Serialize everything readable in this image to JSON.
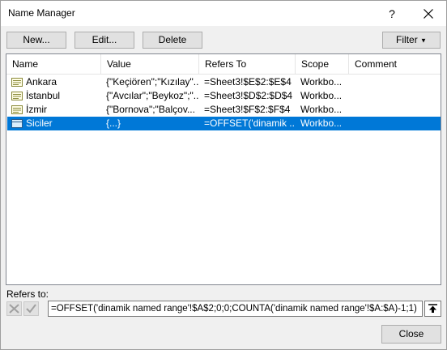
{
  "window": {
    "title": "Name Manager",
    "help_label": "?"
  },
  "toolbar": {
    "new_label": "New...",
    "edit_label": "Edit...",
    "delete_label": "Delete",
    "filter_label": "Filter"
  },
  "table": {
    "columns": [
      "Name",
      "Value",
      "Refers To",
      "Scope",
      "Comment"
    ],
    "rows": [
      {
        "name": "Ankara",
        "value": "{\"Keçiören\";\"Kızılay\"...",
        "refers_to": "=Sheet3!$E$2:$E$4",
        "scope": "Workbo...",
        "comment": "",
        "selected": false
      },
      {
        "name": "İstanbul",
        "value": "{\"Avcılar\";\"Beykoz\";\"...",
        "refers_to": "=Sheet3!$D$2:$D$4",
        "scope": "Workbo...",
        "comment": "",
        "selected": false
      },
      {
        "name": "İzmir",
        "value": "{\"Bornova\";\"Balçov...",
        "refers_to": "=Sheet3!$F$2:$F$4",
        "scope": "Workbo...",
        "comment": "",
        "selected": false
      },
      {
        "name": "Siciler",
        "value": "{...}",
        "refers_to": "=OFFSET('dinamik ...",
        "scope": "Workbo...",
        "comment": "",
        "selected": true
      }
    ]
  },
  "refers": {
    "label": "Refers to:",
    "value": "=OFFSET('dinamik named range'!$A$2;0;0;COUNTA('dinamik named range'!$A:$A)-1;1)"
  },
  "footer": {
    "close_label": "Close"
  },
  "colors": {
    "selection": "#0078d7",
    "dialog_bg": "#f0f0f0",
    "button_bg": "#e1e1e1"
  }
}
